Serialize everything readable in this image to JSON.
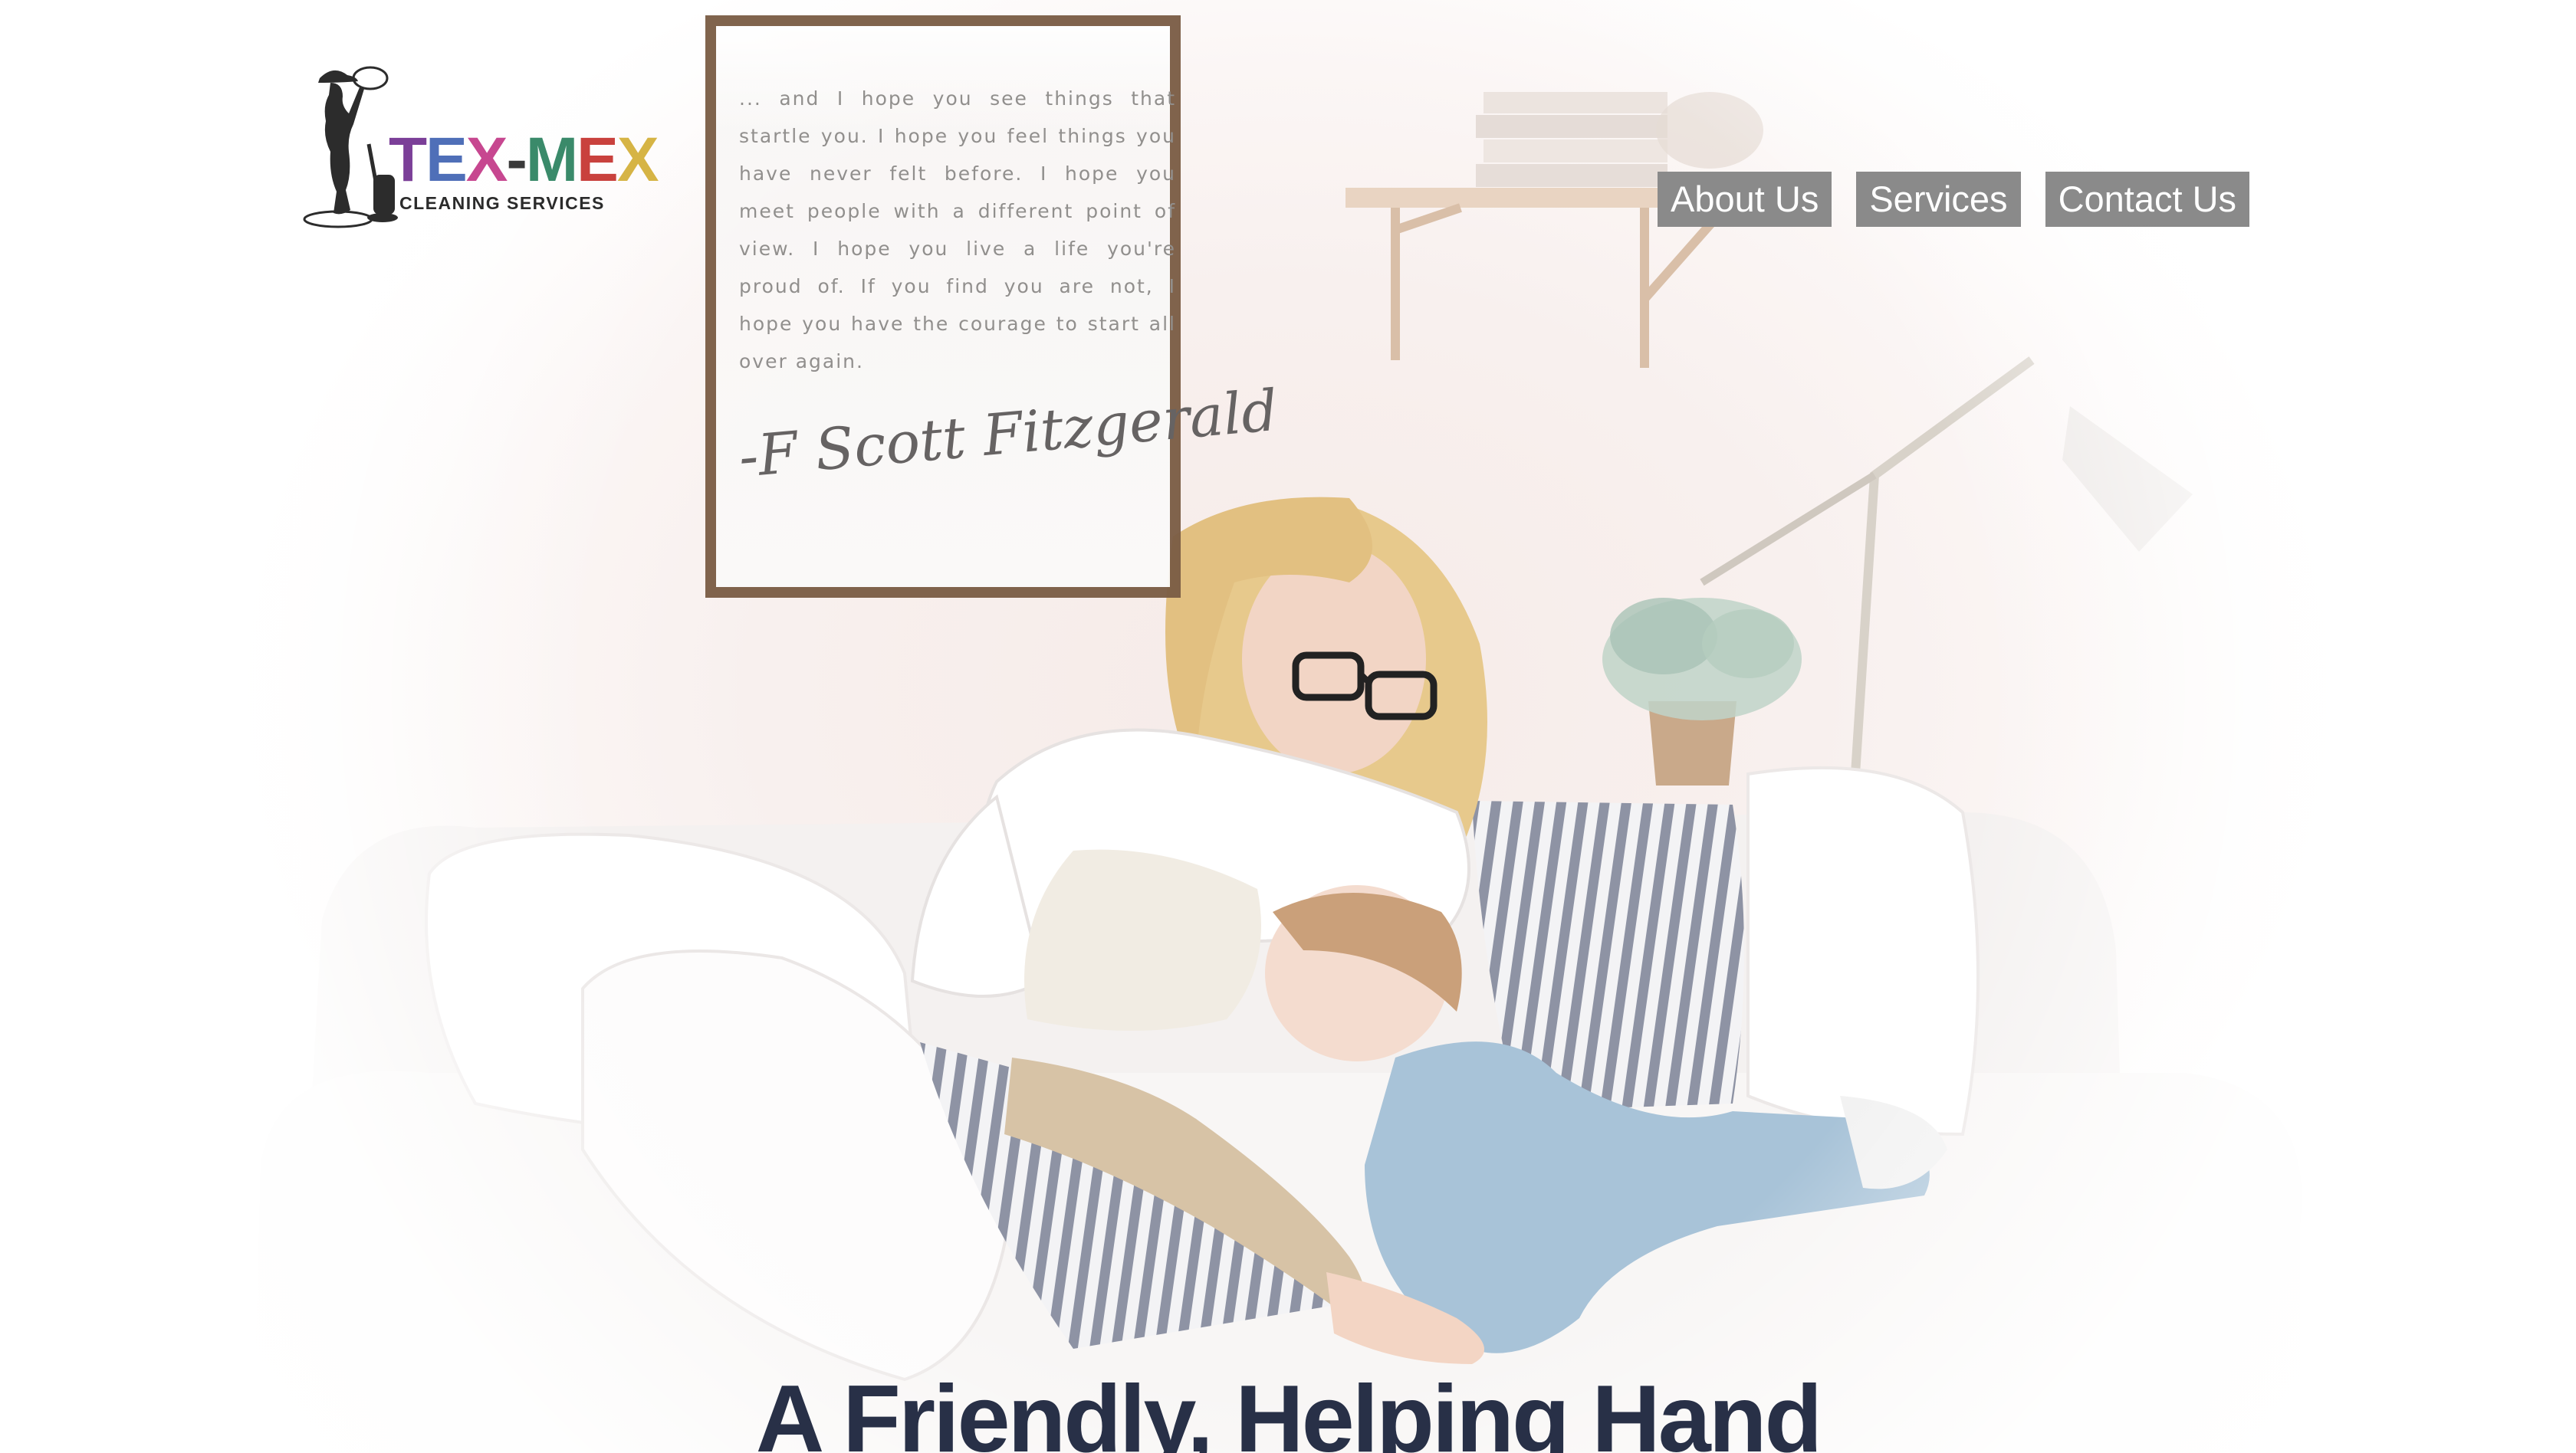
{
  "logo": {
    "title_parts": [
      {
        "text": "T",
        "color": "#7b3f98"
      },
      {
        "text": "E",
        "color": "#4f6fb8"
      },
      {
        "text": "X",
        "color": "#c74790"
      },
      {
        "text": "-",
        "color": "#3a3a3a"
      },
      {
        "text": "M",
        "color": "#3a8a6a"
      },
      {
        "text": "E",
        "color": "#c9413d"
      },
      {
        "text": "X",
        "color": "#d6b445"
      }
    ],
    "subtitle": "CLEANING SERVICES",
    "icon": "cowgirl-vacuum-silhouette-icon"
  },
  "nav": {
    "items": [
      {
        "label": "About Us"
      },
      {
        "label": "Services"
      },
      {
        "label": "Contact Us"
      }
    ]
  },
  "hero": {
    "quote": "... and I hope you see things that startle you. I hope you feel things you have never felt before. I hope you meet people with a different point of view. I hope you live a life you're proud of. If you find you are not, I hope you have the courage to start all over again.",
    "signature": "-F Scott Fitzgerald"
  },
  "headline": "A Friendly, Helping Hand",
  "colors": {
    "nav_bg": "#8a8a8a",
    "nav_text": "#ffffff",
    "headline": "#283047"
  }
}
